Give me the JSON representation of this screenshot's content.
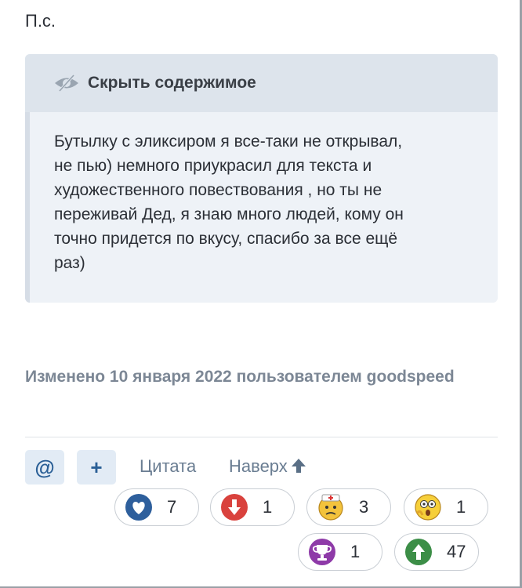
{
  "post": {
    "ps": "П.с."
  },
  "spoiler": {
    "title": "Скрыть содержимое",
    "text": "Бутылку с эликсиром я все-таки не открывал,\nне пью) немного приукрасил для текста и\nхудожественного повествования , но ты не\nпереживай Дед, я знаю много людей, кому он\nточно придется по вкусу, спасибо за все ещё\nраз)"
  },
  "edited": "Изменено 10 января 2022 пользователем goodspeed",
  "actions": {
    "mention_label": "@",
    "plus_label": "+",
    "quote_label": "Цитата",
    "top_label": "Наверх"
  },
  "reactions": [
    {
      "name": "heart",
      "count": "7"
    },
    {
      "name": "dislike",
      "count": "1"
    },
    {
      "name": "facepalm",
      "count": "3"
    },
    {
      "name": "shocked",
      "count": "1"
    },
    {
      "name": "trophy",
      "count": "1"
    },
    {
      "name": "like",
      "count": "47"
    }
  ],
  "colors": {
    "accent": "#2a5f96",
    "heart": "#2e5f9c",
    "dislike": "#d9423d",
    "trophy": "#8e3aa8",
    "like": "#3c8e47"
  }
}
